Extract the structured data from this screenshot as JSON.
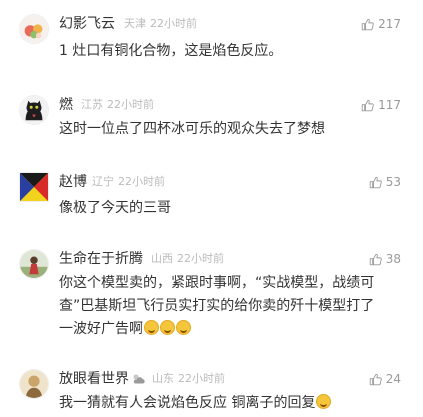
{
  "comments": [
    {
      "username": "幻影飞云",
      "location": "天津",
      "time": "22小时前",
      "likes": "217",
      "lines": [
        "1 灶口有铜化合物，这是焰色反应。"
      ]
    },
    {
      "username": "燃",
      "location": "江苏",
      "time": "22小时前",
      "likes": "117",
      "lines": [
        "这时一位点了四杯冰可乐的观众失去了梦想"
      ]
    },
    {
      "username": "赵博",
      "location": "辽宁",
      "time": "22小时前",
      "likes": "53",
      "lines": [
        "像极了今天的三哥"
      ]
    },
    {
      "username": "生命在于折腾",
      "location": "山西",
      "time": "22小时前",
      "likes": "38",
      "lines": [
        "你这个模型卖的，紧跟时事啊，“实战模型，战绩可",
        "查”巴基斯坦飞行员实打实的给你卖的歼十模型打了",
        "一波好广告啊"
      ]
    },
    {
      "username": "放眼看世界",
      "location": "山东",
      "time": "22小时前",
      "likes": "24",
      "lines": [
        "我一猜就有人会说焰色反应 铜离子的回复"
      ]
    }
  ],
  "icons": {
    "like": "thumbs-up-icon",
    "emoji_laugh_cry": "laughing-crying-emoji-icon",
    "emoji_grin": "grinning-emoji-icon",
    "weather": "sun-cloud-icon"
  },
  "colors": {
    "text": "#333333",
    "meta": "#bbbbbb",
    "likes": "#999999"
  }
}
